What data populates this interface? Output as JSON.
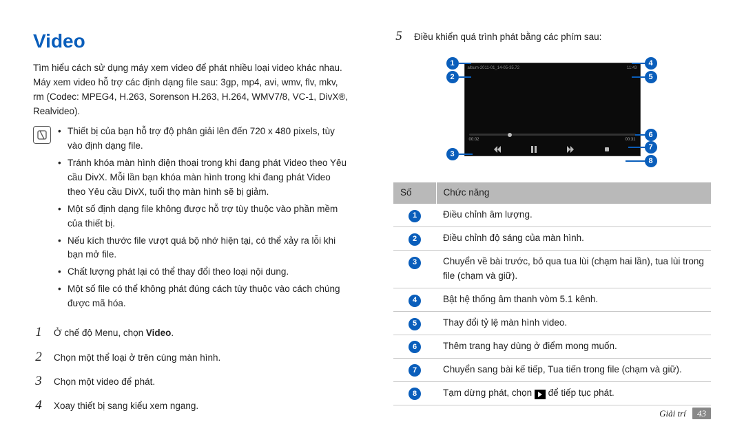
{
  "title": "Video",
  "intro": "Tìm hiểu cách sử dụng máy xem video để phát nhiều loại video khác nhau. Máy xem video hỗ trợ các định dạng file sau: 3gp, mp4, avi, wmv, flv, mkv, rm (Codec: MPEG4, H.263, Sorenson H.263, H.264, WMV7/8, VC-1, DivX®, Realvideo).",
  "note_bullets": [
    "Thiết bị của bạn hỗ trợ độ phân giải lên đến 720 x 480 pixels, tùy vào định dạng file.",
    "Tránh khóa màn hình điện thoại trong khi đang phát Video theo Yêu cầu DivX. Mỗi lần bạn khóa màn hình trong khi đang phát Video theo Yêu cầu DivX, tuổi thọ màn hình sẽ bị giảm.",
    "Một số định dạng file không được hỗ trợ tùy thuộc vào phần mềm của thiết bị.",
    "Nếu kích thước file vượt quá bộ nhớ hiện tại, có thể xảy ra lỗi khi bạn mở file.",
    "Chất lượng phát lại có thể thay đổi theo loại nội dung.",
    "Một số file có thể không phát đúng cách tùy thuộc vào cách chúng được mã hóa."
  ],
  "steps_left": [
    {
      "n": "1",
      "text_pre": "Ở chế độ Menu, chọn ",
      "bold": "Video",
      "text_post": "."
    },
    {
      "n": "2",
      "text_pre": "Chọn một thể loại ở trên cùng màn hình.",
      "bold": "",
      "text_post": ""
    },
    {
      "n": "3",
      "text_pre": "Chọn một video để phát.",
      "bold": "",
      "text_post": ""
    },
    {
      "n": "4",
      "text_pre": "Xoay thiết bị sang kiểu xem ngang.",
      "bold": "",
      "text_post": ""
    }
  ],
  "step5": {
    "n": "5",
    "text": "Điều khiển quá trình phát bằng các phím sau:"
  },
  "table": {
    "header": [
      "Số",
      "Chức năng"
    ],
    "rows": [
      {
        "n": "1",
        "desc": "Điều chỉnh âm lượng."
      },
      {
        "n": "2",
        "desc": "Điều chỉnh độ sáng của màn hình."
      },
      {
        "n": "3",
        "desc": "Chuyển về bài trước, bỏ qua tua lùi (chạm hai lần), tua lùi trong file (chạm và giữ)."
      },
      {
        "n": "4",
        "desc": "Bật hệ thống âm thanh vòm 5.1 kênh."
      },
      {
        "n": "5",
        "desc": "Thay đổi tỷ lệ màn hình video."
      },
      {
        "n": "6",
        "desc": "Thêm trang hay dùng ở điểm mong muốn."
      },
      {
        "n": "7",
        "desc": "Chuyển sang bài kế tiếp, Tua tiến trong file (chạm và giữ)."
      },
      {
        "n": "8",
        "desc_pre": "Tạm dừng phát, chọn ",
        "desc_post": " để tiếp tục phát."
      }
    ]
  },
  "player": {
    "top_left": "album-2011-01_14-05-35.72",
    "top_right": "11:43",
    "time_left": "00:02",
    "time_right": "00:31"
  },
  "footer": {
    "section": "Giải trí",
    "page": "43"
  }
}
